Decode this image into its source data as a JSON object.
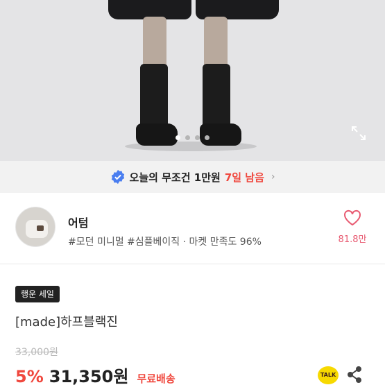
{
  "gallery": {
    "slide_count": 4,
    "active_slide": 1,
    "expand_icon": "expand-icon"
  },
  "promo": {
    "text": "오늘의 무조건 1만원",
    "days_left": "7일 남음",
    "chevron": "›",
    "badge_color": "#4a7ef0"
  },
  "store": {
    "name": "어텀",
    "tags": "#모던 미니멀 #심플베이직 · 마켓 만족도 96%",
    "favorite_count": "81.8만",
    "heart_color": "#e85a71"
  },
  "product": {
    "sale_badge": "행운 세일",
    "title": "[made]하프블랙진",
    "original_price": "33,000원",
    "discount": "5%",
    "price": "31,350원",
    "shipping": "무료배송",
    "accent_color": "#f0483e"
  },
  "actions": {
    "talk_label": "TALK",
    "share_icon": "share-icon"
  }
}
